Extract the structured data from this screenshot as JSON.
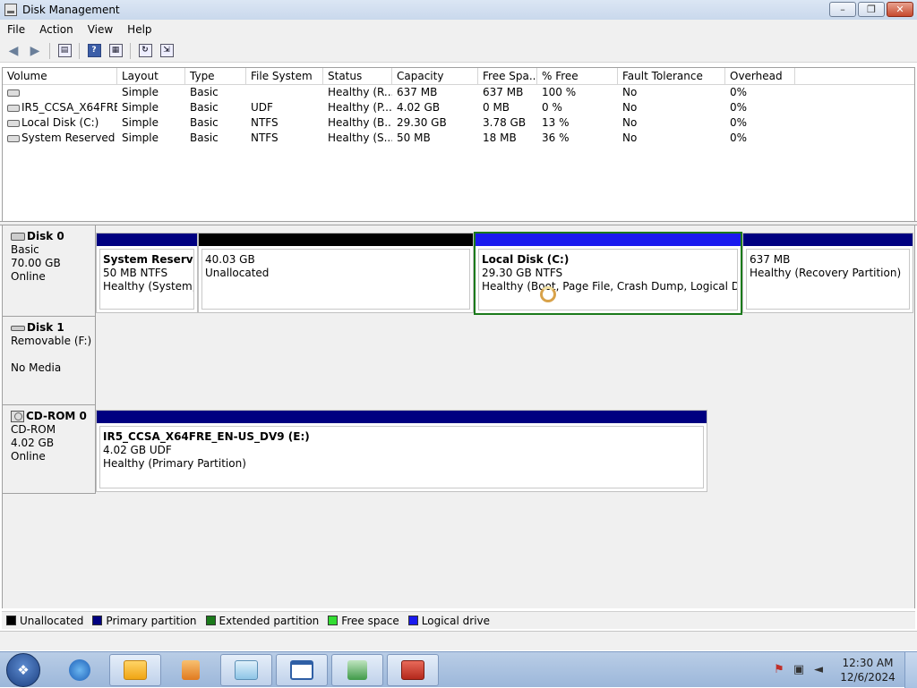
{
  "window": {
    "title": "Disk Management",
    "minimize": "–",
    "restore": "❐",
    "close": "✕"
  },
  "menu": [
    "File",
    "Action",
    "View",
    "Help"
  ],
  "toolbar": {
    "back": "◀",
    "forward": "▶",
    "console": "▤",
    "help": "?",
    "properties": "▦",
    "refresh": "↻",
    "export": "⇲"
  },
  "volumes": {
    "columns": [
      "Volume",
      "Layout",
      "Type",
      "File System",
      "Status",
      "Capacity",
      "Free Spa...",
      "% Free",
      "Fault Tolerance",
      "Overhead"
    ],
    "rows": [
      {
        "volume": "",
        "layout": "Simple",
        "type": "Basic",
        "fs": "",
        "status": "Healthy (R...",
        "capacity": "637 MB",
        "free": "637 MB",
        "pct": "100 %",
        "fault": "No",
        "overhead": "0%"
      },
      {
        "volume": "IR5_CCSA_X64FRE...",
        "layout": "Simple",
        "type": "Basic",
        "fs": "UDF",
        "status": "Healthy (P...",
        "capacity": "4.02 GB",
        "free": "0 MB",
        "pct": "0 %",
        "fault": "No",
        "overhead": "0%"
      },
      {
        "volume": "Local Disk (C:)",
        "layout": "Simple",
        "type": "Basic",
        "fs": "NTFS",
        "status": "Healthy (B...",
        "capacity": "29.30 GB",
        "free": "3.78 GB",
        "pct": "13 %",
        "fault": "No",
        "overhead": "0%"
      },
      {
        "volume": "System Reserved",
        "layout": "Simple",
        "type": "Basic",
        "fs": "NTFS",
        "status": "Healthy (S...",
        "capacity": "50 MB",
        "free": "18 MB",
        "pct": "36 %",
        "fault": "No",
        "overhead": "0%"
      }
    ]
  },
  "disks": {
    "disk0": {
      "name": "Disk 0",
      "type": "Basic",
      "size": "70.00 GB",
      "state": "Online",
      "partitions": [
        {
          "name": "System Reserved",
          "line1": "50 MB NTFS",
          "line2": "Healthy (System, A"
        },
        {
          "name": "",
          "line1": "40.03 GB",
          "line2": "Unallocated"
        },
        {
          "name": "Local Disk  (C:)",
          "line1": "29.30 GB NTFS",
          "line2": "Healthy (Boot, Page File, Crash Dump, Logical Drive)"
        },
        {
          "name": "",
          "line1": "637 MB",
          "line2": "Healthy (Recovery Partition)"
        }
      ]
    },
    "disk1": {
      "name": "Disk 1",
      "type": "Removable (F:)",
      "state": "No Media"
    },
    "cdrom0": {
      "name": "CD-ROM 0",
      "type": "CD-ROM",
      "size": "4.02 GB",
      "state": "Online",
      "partition": {
        "name": "IR5_CCSA_X64FRE_EN-US_DV9  (E:)",
        "line1": "4.02 GB UDF",
        "line2": "Healthy (Primary Partition)"
      }
    }
  },
  "legend": [
    {
      "label": "Unallocated",
      "color": "#000000"
    },
    {
      "label": "Primary partition",
      "color": "#000080"
    },
    {
      "label": "Extended partition",
      "color": "#1b7a1b"
    },
    {
      "label": "Free space",
      "color": "#33dd33"
    },
    {
      "label": "Logical drive",
      "color": "#1a1aee"
    }
  ],
  "taskbar": {
    "clock_time": "12:30 AM",
    "clock_date": "12/6/2024",
    "apps": [
      "internet-explorer",
      "file-explorer",
      "media-player",
      "notepad",
      "window-app",
      "hardware-app",
      "disk-management"
    ]
  },
  "colors": {
    "primary_bar": "#000080",
    "unallocated_bar": "#000000",
    "logical_bar": "#1a1aee",
    "selection": "#1b7a1b"
  }
}
